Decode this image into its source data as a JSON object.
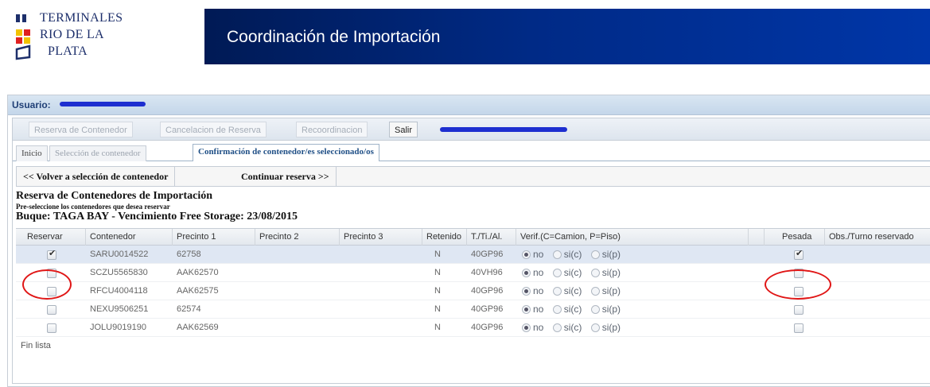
{
  "logo": {
    "line1": "Terminales",
    "line2": "Rio de la",
    "line3": "Plata"
  },
  "banner": {
    "title": "Coordinación de Importación"
  },
  "user": {
    "label": "Usuario:"
  },
  "menu": {
    "reserva": "Reserva de Contenedor",
    "cancelacion": "Cancelacion de Reserva",
    "recoordinacion": "Recoordinacion",
    "salir": "Salir"
  },
  "tabs": {
    "inicio": "Inicio",
    "seleccion": "Selección de contenedor",
    "confirmacion": "Confirmación de contenedor/es seleccionado/os"
  },
  "actions": {
    "volver": "<< Volver a selección de contenedor",
    "continuar": "Continuar reserva >>"
  },
  "heading": {
    "title": "Reserva de Contenedores de Importación",
    "subtitle": "Pre-seleccione los contenedores que desea reservar",
    "buque": "Buque: TAGA BAY - Vencimiento Free Storage: 23/08/2015"
  },
  "table": {
    "headers": [
      "Reservar",
      "Contenedor",
      "Precinto 1",
      "Precinto 2",
      "Precinto 3",
      "Retenido",
      "T./Ti./Al.",
      "Verif.(C=Camion, P=Piso)",
      "Pesada",
      "Obs./Turno reservado"
    ],
    "radio_labels": [
      "no",
      "si(c)",
      "si(p)"
    ],
    "rows": [
      {
        "contenedor": "SARU0014522",
        "precinto1": "62758",
        "retenido": "N",
        "tipo": "40GP96",
        "reservar": true,
        "pesada": true
      },
      {
        "contenedor": "SCZU5565830",
        "precinto1": "AAK62570",
        "retenido": "N",
        "tipo": "40VH96",
        "reservar": false,
        "pesada": false
      },
      {
        "contenedor": "RFCU4004118",
        "precinto1": "AAK62575",
        "retenido": "N",
        "tipo": "40GP96",
        "reservar": false,
        "pesada": false
      },
      {
        "contenedor": "NEXU9506251",
        "precinto1": "62574",
        "retenido": "N",
        "tipo": "40GP96",
        "reservar": false,
        "pesada": false
      },
      {
        "contenedor": "JOLU9019190",
        "precinto1": "AAK62569",
        "retenido": "N",
        "tipo": "40GP96",
        "reservar": false,
        "pesada": false
      }
    ],
    "footer": "Fin lista"
  },
  "colors": {
    "banner": "#002a86",
    "accent_circle": "#e01616",
    "redaction": "#1e2fd0"
  }
}
